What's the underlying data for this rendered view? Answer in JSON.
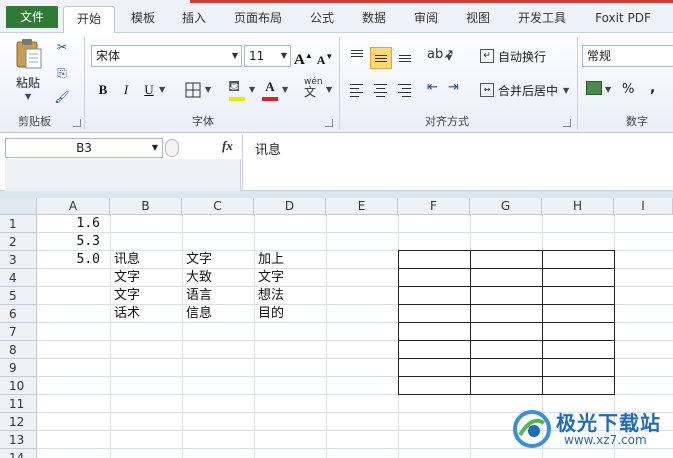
{
  "tabs": {
    "file": "文件",
    "items": [
      "开始",
      "模板",
      "插入",
      "页面布局",
      "公式",
      "数据",
      "审阅",
      "视图",
      "开发工具",
      "Foxit PDF"
    ]
  },
  "ribbon": {
    "clipboard": {
      "paste": "粘贴",
      "group": "剪贴板"
    },
    "font": {
      "name": "宋体",
      "size": "11",
      "group": "字体",
      "grow": "A",
      "shrink": "A",
      "bold": "B",
      "italic": "I",
      "underline": "U",
      "phonetic": "wén"
    },
    "alignment": {
      "wrap": "自动换行",
      "merge": "合并后居中",
      "group": "对齐方式"
    },
    "number": {
      "format": "常规",
      "percent": "%",
      "comma": ",",
      "group": "数字"
    }
  },
  "formula_bar": {
    "name_box": "B3",
    "fx": "fx",
    "content": "讯息"
  },
  "grid": {
    "columns": [
      "A",
      "B",
      "C",
      "D",
      "E",
      "F",
      "G",
      "H",
      "I"
    ],
    "rows": [
      "1",
      "2",
      "3",
      "4",
      "5",
      "6",
      "7",
      "8",
      "9",
      "10",
      "11",
      "12",
      "13",
      "14"
    ],
    "col_a": [
      "1.6",
      "5.3",
      "5.0"
    ],
    "col_b": [
      "讯息",
      "文字",
      "文字",
      "话术"
    ],
    "col_c": [
      "文字",
      "大致",
      "语言",
      "信息"
    ],
    "col_d": [
      "加上",
      "文字",
      "想法",
      "目的"
    ]
  },
  "watermark": {
    "title": "极光下载站",
    "url": "www.xz7.com"
  }
}
